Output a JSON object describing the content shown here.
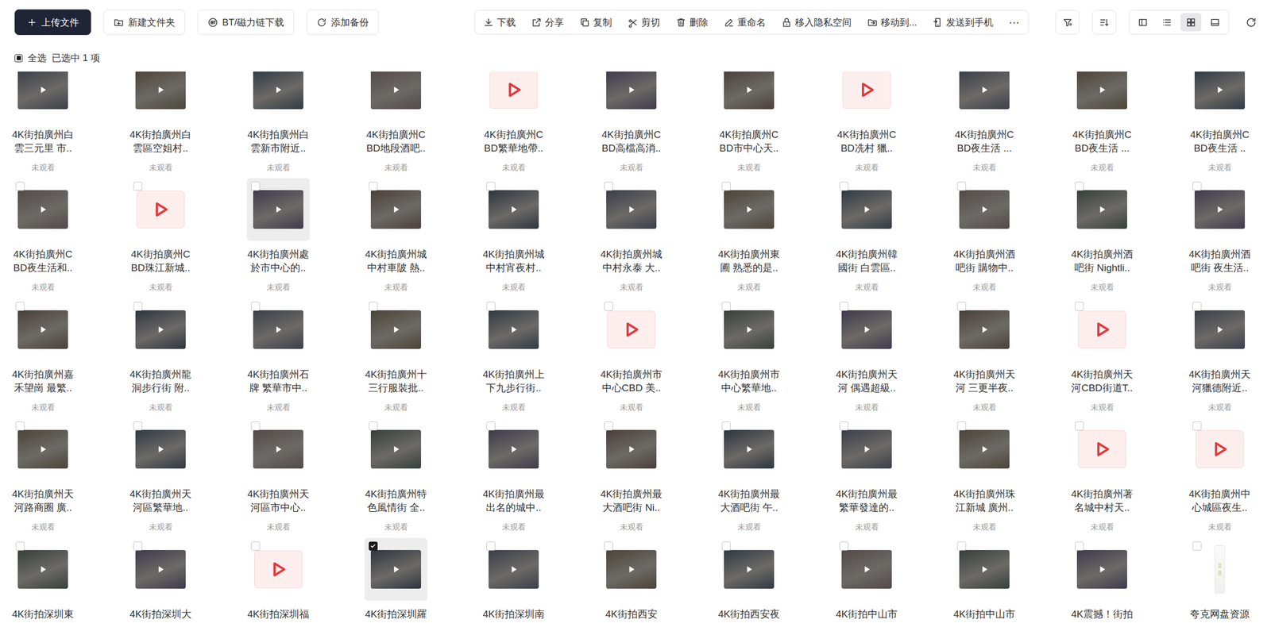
{
  "toolbar": {
    "buttons": [
      {
        "label": "上传文件",
        "primary": true
      },
      {
        "label": "新建文件夹",
        "primary": false
      },
      {
        "label": "BT/磁力链下载",
        "primary": false
      },
      {
        "label": "添加备份",
        "primary": false
      }
    ],
    "actions": [
      "下载",
      "分享",
      "复制",
      "剪切",
      "删除",
      "重命名",
      "移入隐私空间",
      "移动到...",
      "发送到手机"
    ],
    "more": "⋯",
    "view_modes": [
      {
        "selected": false
      },
      {
        "selected": false
      },
      {
        "selected": true
      },
      {
        "selected": false
      }
    ]
  },
  "selection": {
    "select_all": "全选",
    "indeterminate": true,
    "summary": "已选中 1 项"
  },
  "files": [
    {
      "name": [
        "4K街拍廣州白",
        "雲三元里 市.."
      ],
      "status": "未观看",
      "kind": "video",
      "checked": false,
      "highlighted": false
    },
    {
      "name": [
        "4K街拍廣州白",
        "雲區空姐村.."
      ],
      "status": "未观看",
      "kind": "video",
      "checked": false,
      "highlighted": false
    },
    {
      "name": [
        "4K街拍廣州白",
        "雲新市附近.."
      ],
      "status": "未观看",
      "kind": "video",
      "checked": false,
      "highlighted": false
    },
    {
      "name": [
        "4K街拍廣州C",
        "BD地段酒吧.."
      ],
      "status": "未观看",
      "kind": "video",
      "checked": false,
      "highlighted": false
    },
    {
      "name": [
        "4K街拍廣州C",
        "BD繁華地帶.."
      ],
      "status": "未观看",
      "kind": "placeholder",
      "checked": false,
      "highlighted": false
    },
    {
      "name": [
        "4K街拍廣州C",
        "BD高檔高消.."
      ],
      "status": "未观看",
      "kind": "video",
      "checked": false,
      "highlighted": false
    },
    {
      "name": [
        "4K街拍廣州C",
        "BD市中心天.."
      ],
      "status": "未观看",
      "kind": "video",
      "checked": false,
      "highlighted": false
    },
    {
      "name": [
        "4K街拍廣州C",
        "BD冼村 獵.."
      ],
      "status": "未观看",
      "kind": "placeholder",
      "checked": false,
      "highlighted": false
    },
    {
      "name": [
        "4K街拍廣州C",
        "BD夜生活 ..."
      ],
      "status": "未观看",
      "kind": "video",
      "checked": false,
      "highlighted": false
    },
    {
      "name": [
        "4K街拍廣州C",
        "BD夜生活 ..."
      ],
      "status": "未观看",
      "kind": "video",
      "checked": false,
      "highlighted": false
    },
    {
      "name": [
        "4K街拍廣州C",
        "BD夜生活 .."
      ],
      "status": "未观看",
      "kind": "video",
      "checked": false,
      "highlighted": false
    },
    {
      "name": [
        "4K街拍廣州C",
        "BD夜生活和.."
      ],
      "status": "未观看",
      "kind": "video",
      "checked": false,
      "highlighted": false
    },
    {
      "name": [
        "4K街拍廣州C",
        "BD珠江新城.."
      ],
      "status": "未观看",
      "kind": "placeholder",
      "checked": false,
      "highlighted": false
    },
    {
      "name": [
        "4K街拍廣州處",
        "於市中心的.."
      ],
      "status": "未观看",
      "kind": "video",
      "checked": false,
      "highlighted": true
    },
    {
      "name": [
        "4K街拍廣州城",
        "中村車陂 熱.."
      ],
      "status": "未观看",
      "kind": "video",
      "checked": false,
      "highlighted": false
    },
    {
      "name": [
        "4K街拍廣州城",
        "中村宵夜村.."
      ],
      "status": "未观看",
      "kind": "video",
      "checked": false,
      "highlighted": false
    },
    {
      "name": [
        "4K街拍廣州城",
        "中村永泰 大.."
      ],
      "status": "未观看",
      "kind": "video",
      "checked": false,
      "highlighted": false
    },
    {
      "name": [
        "4K街拍廣州東",
        "圃 熟悉的是.."
      ],
      "status": "未观看",
      "kind": "video",
      "checked": false,
      "highlighted": false
    },
    {
      "name": [
        "4K街拍廣州韓",
        "國街 白雲區.."
      ],
      "status": "未观看",
      "kind": "video",
      "checked": false,
      "highlighted": false
    },
    {
      "name": [
        "4K街拍廣州酒",
        "吧街 購物中.."
      ],
      "status": "未观看",
      "kind": "video",
      "checked": false,
      "highlighted": false
    },
    {
      "name": [
        "4K街拍廣州酒",
        "吧街 Nightli.."
      ],
      "status": "未观看",
      "kind": "video",
      "checked": false,
      "highlighted": false
    },
    {
      "name": [
        "4K街拍廣州酒",
        "吧街 夜生活.."
      ],
      "status": "未观看",
      "kind": "video",
      "checked": false,
      "highlighted": false
    },
    {
      "name": [
        "4K街拍廣州嘉",
        "禾望崗 最繁.."
      ],
      "status": "未观看",
      "kind": "video",
      "checked": false,
      "highlighted": false
    },
    {
      "name": [
        "4K街拍廣州龍",
        "洞步行街 附.."
      ],
      "status": "未观看",
      "kind": "video",
      "checked": false,
      "highlighted": false
    },
    {
      "name": [
        "4K街拍廣州石",
        "牌 繁華市中.."
      ],
      "status": "未观看",
      "kind": "video",
      "checked": false,
      "highlighted": false
    },
    {
      "name": [
        "4K街拍廣州十",
        "三行服裝批.."
      ],
      "status": "未观看",
      "kind": "video",
      "checked": false,
      "highlighted": false
    },
    {
      "name": [
        "4K街拍廣州上",
        "下九步行街.."
      ],
      "status": "未观看",
      "kind": "video",
      "checked": false,
      "highlighted": false
    },
    {
      "name": [
        "4K街拍廣州市",
        "中心CBD 美.."
      ],
      "status": "未观看",
      "kind": "placeholder",
      "checked": false,
      "highlighted": false
    },
    {
      "name": [
        "4K街拍廣州市",
        "中心繁華地.."
      ],
      "status": "未观看",
      "kind": "video",
      "checked": false,
      "highlighted": false
    },
    {
      "name": [
        "4K街拍廣州天",
        "河 偶遇超級.."
      ],
      "status": "未观看",
      "kind": "video",
      "checked": false,
      "highlighted": false
    },
    {
      "name": [
        "4K街拍廣州天",
        "河 三更半夜.."
      ],
      "status": "未观看",
      "kind": "video",
      "checked": false,
      "highlighted": false
    },
    {
      "name": [
        "4K街拍廣州天",
        "河CBD街道T.."
      ],
      "status": "未观看",
      "kind": "placeholder",
      "checked": false,
      "highlighted": false
    },
    {
      "name": [
        "4K街拍廣州天",
        "河獵德附近.."
      ],
      "status": "未观看",
      "kind": "video",
      "checked": false,
      "highlighted": false
    },
    {
      "name": [
        "4K街拍廣州天",
        "河路商圈 廣.."
      ],
      "status": "未观看",
      "kind": "video",
      "checked": false,
      "highlighted": false
    },
    {
      "name": [
        "4K街拍廣州天",
        "河區繁華地.."
      ],
      "status": "未观看",
      "kind": "video",
      "checked": false,
      "highlighted": false
    },
    {
      "name": [
        "4K街拍廣州天",
        "河區市中心.."
      ],
      "status": "未观看",
      "kind": "video",
      "checked": false,
      "highlighted": false
    },
    {
      "name": [
        "4K街拍廣州特",
        "色風情街 全.."
      ],
      "status": "未观看",
      "kind": "video",
      "checked": false,
      "highlighted": false
    },
    {
      "name": [
        "4K街拍廣州最",
        "出名的城中.."
      ],
      "status": "未观看",
      "kind": "video",
      "checked": false,
      "highlighted": false
    },
    {
      "name": [
        "4K街拍廣州最",
        "大酒吧街 Ni.."
      ],
      "status": "未观看",
      "kind": "video",
      "checked": false,
      "highlighted": false
    },
    {
      "name": [
        "4K街拍廣州最",
        "大酒吧街 午.."
      ],
      "status": "未观看",
      "kind": "video",
      "checked": false,
      "highlighted": false
    },
    {
      "name": [
        "4K街拍廣州最",
        "繁華發達的.."
      ],
      "status": "未观看",
      "kind": "video",
      "checked": false,
      "highlighted": false
    },
    {
      "name": [
        "4K街拍廣州珠",
        "江新城 廣州.."
      ],
      "status": "未观看",
      "kind": "video",
      "checked": false,
      "highlighted": false
    },
    {
      "name": [
        "4K街拍廣州著",
        "名城中村天.."
      ],
      "status": "未观看",
      "kind": "placeholder",
      "checked": false,
      "highlighted": false
    },
    {
      "name": [
        "4K街拍廣州中",
        "心城區夜生.."
      ],
      "status": "未观看",
      "kind": "placeholder",
      "checked": false,
      "highlighted": false
    },
    {
      "name": [
        "4K街拍深圳東"
      ],
      "kind": "video",
      "checked": false,
      "highlighted": false
    },
    {
      "name": [
        "4K街拍深圳大"
      ],
      "kind": "video",
      "checked": false,
      "highlighted": false
    },
    {
      "name": [
        "4K街拍深圳福"
      ],
      "kind": "placeholder",
      "checked": false,
      "highlighted": false
    },
    {
      "name": [
        "4K街拍深圳羅"
      ],
      "kind": "video",
      "checked": true,
      "highlighted": true
    },
    {
      "name": [
        "4K街拍深圳南"
      ],
      "kind": "video",
      "checked": false,
      "highlighted": false
    },
    {
      "name": [
        "4K街拍西安"
      ],
      "kind": "video",
      "checked": false,
      "highlighted": false
    },
    {
      "name": [
        "4K街拍西安夜"
      ],
      "kind": "video",
      "checked": false,
      "highlighted": false
    },
    {
      "name": [
        "4K街拍中山市"
      ],
      "kind": "video",
      "checked": false,
      "highlighted": false
    },
    {
      "name": [
        "4K街拍中山市"
      ],
      "kind": "video",
      "checked": false,
      "highlighted": false
    },
    {
      "name": [
        "4K震撼！街拍"
      ],
      "kind": "video",
      "checked": false,
      "highlighted": false
    },
    {
      "name": [
        "夸克网盘资源"
      ],
      "kind": "image",
      "checked": false,
      "highlighted": false
    }
  ]
}
